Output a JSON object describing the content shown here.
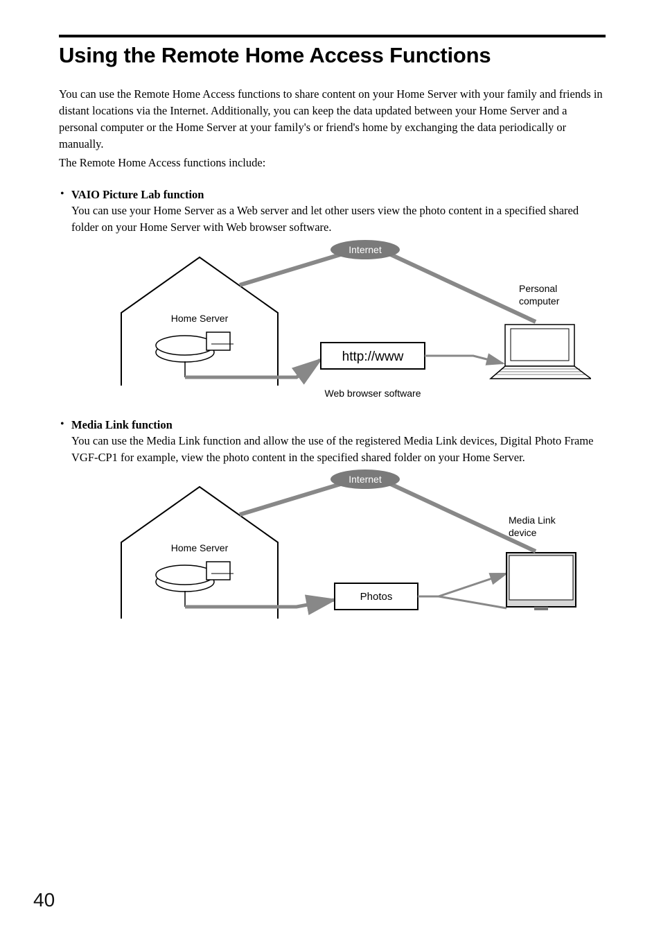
{
  "page": {
    "number": "40",
    "title": "Using the Remote Home Access Functions",
    "intro1": "You can use the Remote Home Access functions to share content on your Home Server with your family and friends in distant locations via the Internet. Additionally, you can keep the data updated between your Home Server and a personal computer or the Home Server at your family's or friend's home by exchanging the data periodically or manually.",
    "intro2": "The Remote Home Access functions include:"
  },
  "functions": [
    {
      "title": "VAIO Picture Lab function",
      "desc": "You can use your Home Server as a Web server and let other users view the photo content in a specified shared folder on your Home Server with Web browser software.",
      "diagram": {
        "internet": "Internet",
        "home_server": "Home Server",
        "right_label_line1": "Personal",
        "right_label_line2": "computer",
        "center_box": "http://www",
        "caption": "Web browser software"
      }
    },
    {
      "title": "Media Link function",
      "desc": "You can use the Media Link function and allow the use of the registered Media Link devices, Digital Photo Frame VGF-CP1 for example, view the photo content in the specified shared folder on your Home Server.",
      "diagram": {
        "internet": "Internet",
        "home_server": "Home Server",
        "right_label_line1": "Media Link",
        "right_label_line2": "device",
        "center_box": "Photos",
        "caption": ""
      }
    }
  ]
}
